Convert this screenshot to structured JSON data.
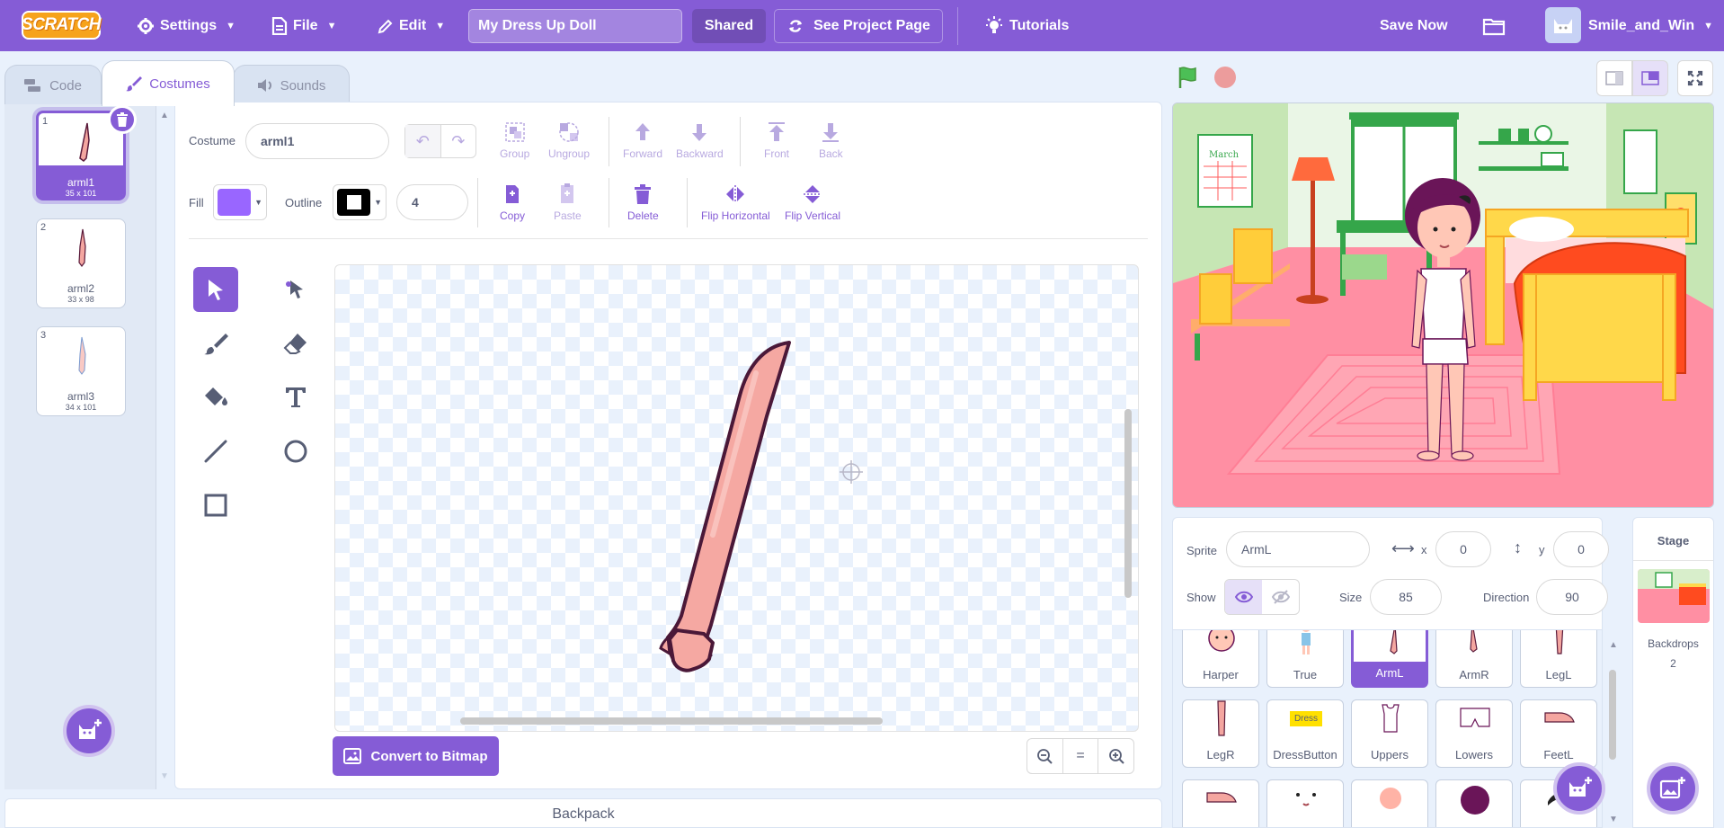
{
  "menubar": {
    "logo": "SCRATCH",
    "settings": "Settings",
    "file": "File",
    "edit": "Edit",
    "project_title": "My Dress Up Doll",
    "shared": "Shared",
    "see_project_page": "See Project Page",
    "tutorials": "Tutorials",
    "save_now": "Save Now",
    "username": "Smile_and_Win"
  },
  "tabs": {
    "code": "Code",
    "costumes": "Costumes",
    "sounds": "Sounds"
  },
  "costumes": [
    {
      "num": "1",
      "name": "arml1",
      "size": "35 x 101"
    },
    {
      "num": "2",
      "name": "arml2",
      "size": "33 x 98"
    },
    {
      "num": "3",
      "name": "arml3",
      "size": "34 x 101"
    }
  ],
  "editor": {
    "costume_label": "Costume",
    "costume_name": "arml1",
    "group": "Group",
    "ungroup": "Ungroup",
    "forward": "Forward",
    "backward": "Backward",
    "front": "Front",
    "back": "Back",
    "fill_label": "Fill",
    "outline_label": "Outline",
    "outline_width": "4",
    "copy": "Copy",
    "paste": "Paste",
    "delete": "Delete",
    "flip_horizontal": "Flip Horizontal",
    "flip_vertical": "Flip Vertical",
    "fill_color": "#9966ff",
    "outline_color": "#000000",
    "convert_to_bitmap": "Convert to Bitmap",
    "zoom_reset": "="
  },
  "backpack": "Backpack",
  "sprite_info": {
    "sprite_label": "Sprite",
    "sprite_name": "ArmL",
    "x_label": "x",
    "x": "0",
    "y_label": "y",
    "y": "0",
    "show_label": "Show",
    "size_label": "Size",
    "size": "85",
    "direction_label": "Direction",
    "direction": "90"
  },
  "sprites": [
    {
      "name": "Harper"
    },
    {
      "name": "True"
    },
    {
      "name": "ArmL"
    },
    {
      "name": "ArmR"
    },
    {
      "name": "LegL"
    },
    {
      "name": "LegR"
    },
    {
      "name": "DressButton",
      "badge": "Dress"
    },
    {
      "name": "Uppers"
    },
    {
      "name": "Lowers"
    },
    {
      "name": "FeetL"
    }
  ],
  "stage_panel": {
    "title": "Stage",
    "backdrops_label": "Backdrops",
    "backdrops_count": "2"
  },
  "stage_scene": {
    "calendar_text": "March"
  },
  "colors": {
    "accent": "#855cd6",
    "menubar": "#855cd6",
    "background": "#e9f1fc"
  }
}
